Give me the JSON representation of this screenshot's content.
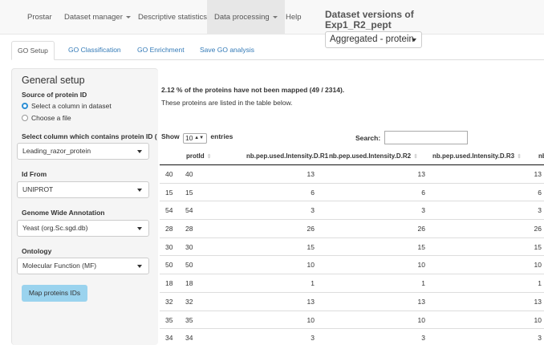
{
  "navbar": {
    "items": [
      {
        "label": "Prostar"
      },
      {
        "label": "Dataset manager"
      },
      {
        "label": "Descriptive statistics"
      },
      {
        "label": "Data processing"
      },
      {
        "label": "Help"
      }
    ],
    "dataset_versions_title": "Dataset versions of Exp1_R2_pept",
    "dataset_version_selected": "Aggregated - protein"
  },
  "tabs": [
    {
      "label": "GO Setup"
    },
    {
      "label": "GO Classification"
    },
    {
      "label": "GO Enrichment"
    },
    {
      "label": "Save GO analysis"
    }
  ],
  "sidebar": {
    "title": "General setup",
    "source_label": "Source of protein ID",
    "radio_options": [
      "Select a column in dataset",
      "Choose a file"
    ],
    "column_label": "Select column which contains protein ID (",
    "column_value": "Leading_razor_protein",
    "idfrom_label": "Id From",
    "idfrom_value": "UNIPROT",
    "genome_label": "Genome Wide Annotation",
    "genome_value": "Yeast (org.Sc.sgd.db)",
    "ontology_label": "Ontology",
    "ontology_value": "Molecular Function (MF)",
    "map_button": "Map proteins IDs"
  },
  "main": {
    "mapping_info": "2.12 % of the proteins have not been mapped (49 / 2314).",
    "mapping_note": "These proteins are listed in the table below.",
    "show_label": "Show",
    "entries_value": "10",
    "entries_label": "entries",
    "search_label": "Search:",
    "search_value": ""
  },
  "table": {
    "headers": [
      "",
      "protId",
      "nb.pep.used.Intensity.D.R1",
      "nb.pep.used.Intensity.D.R2",
      "nb.pep.used.Intensity.D.R3",
      "nb"
    ],
    "rows": [
      [
        "40",
        "40",
        "13",
        "13",
        "13"
      ],
      [
        "15",
        "15",
        "6",
        "6",
        "6"
      ],
      [
        "54",
        "54",
        "3",
        "3",
        "3"
      ],
      [
        "28",
        "28",
        "26",
        "26",
        "26"
      ],
      [
        "30",
        "30",
        "15",
        "15",
        "15"
      ],
      [
        "50",
        "50",
        "10",
        "10",
        "10"
      ],
      [
        "18",
        "18",
        "1",
        "1",
        "1"
      ],
      [
        "32",
        "32",
        "13",
        "13",
        "13"
      ],
      [
        "35",
        "35",
        "10",
        "10",
        "10"
      ],
      [
        "34",
        "34",
        "3",
        "3",
        "3"
      ]
    ]
  }
}
